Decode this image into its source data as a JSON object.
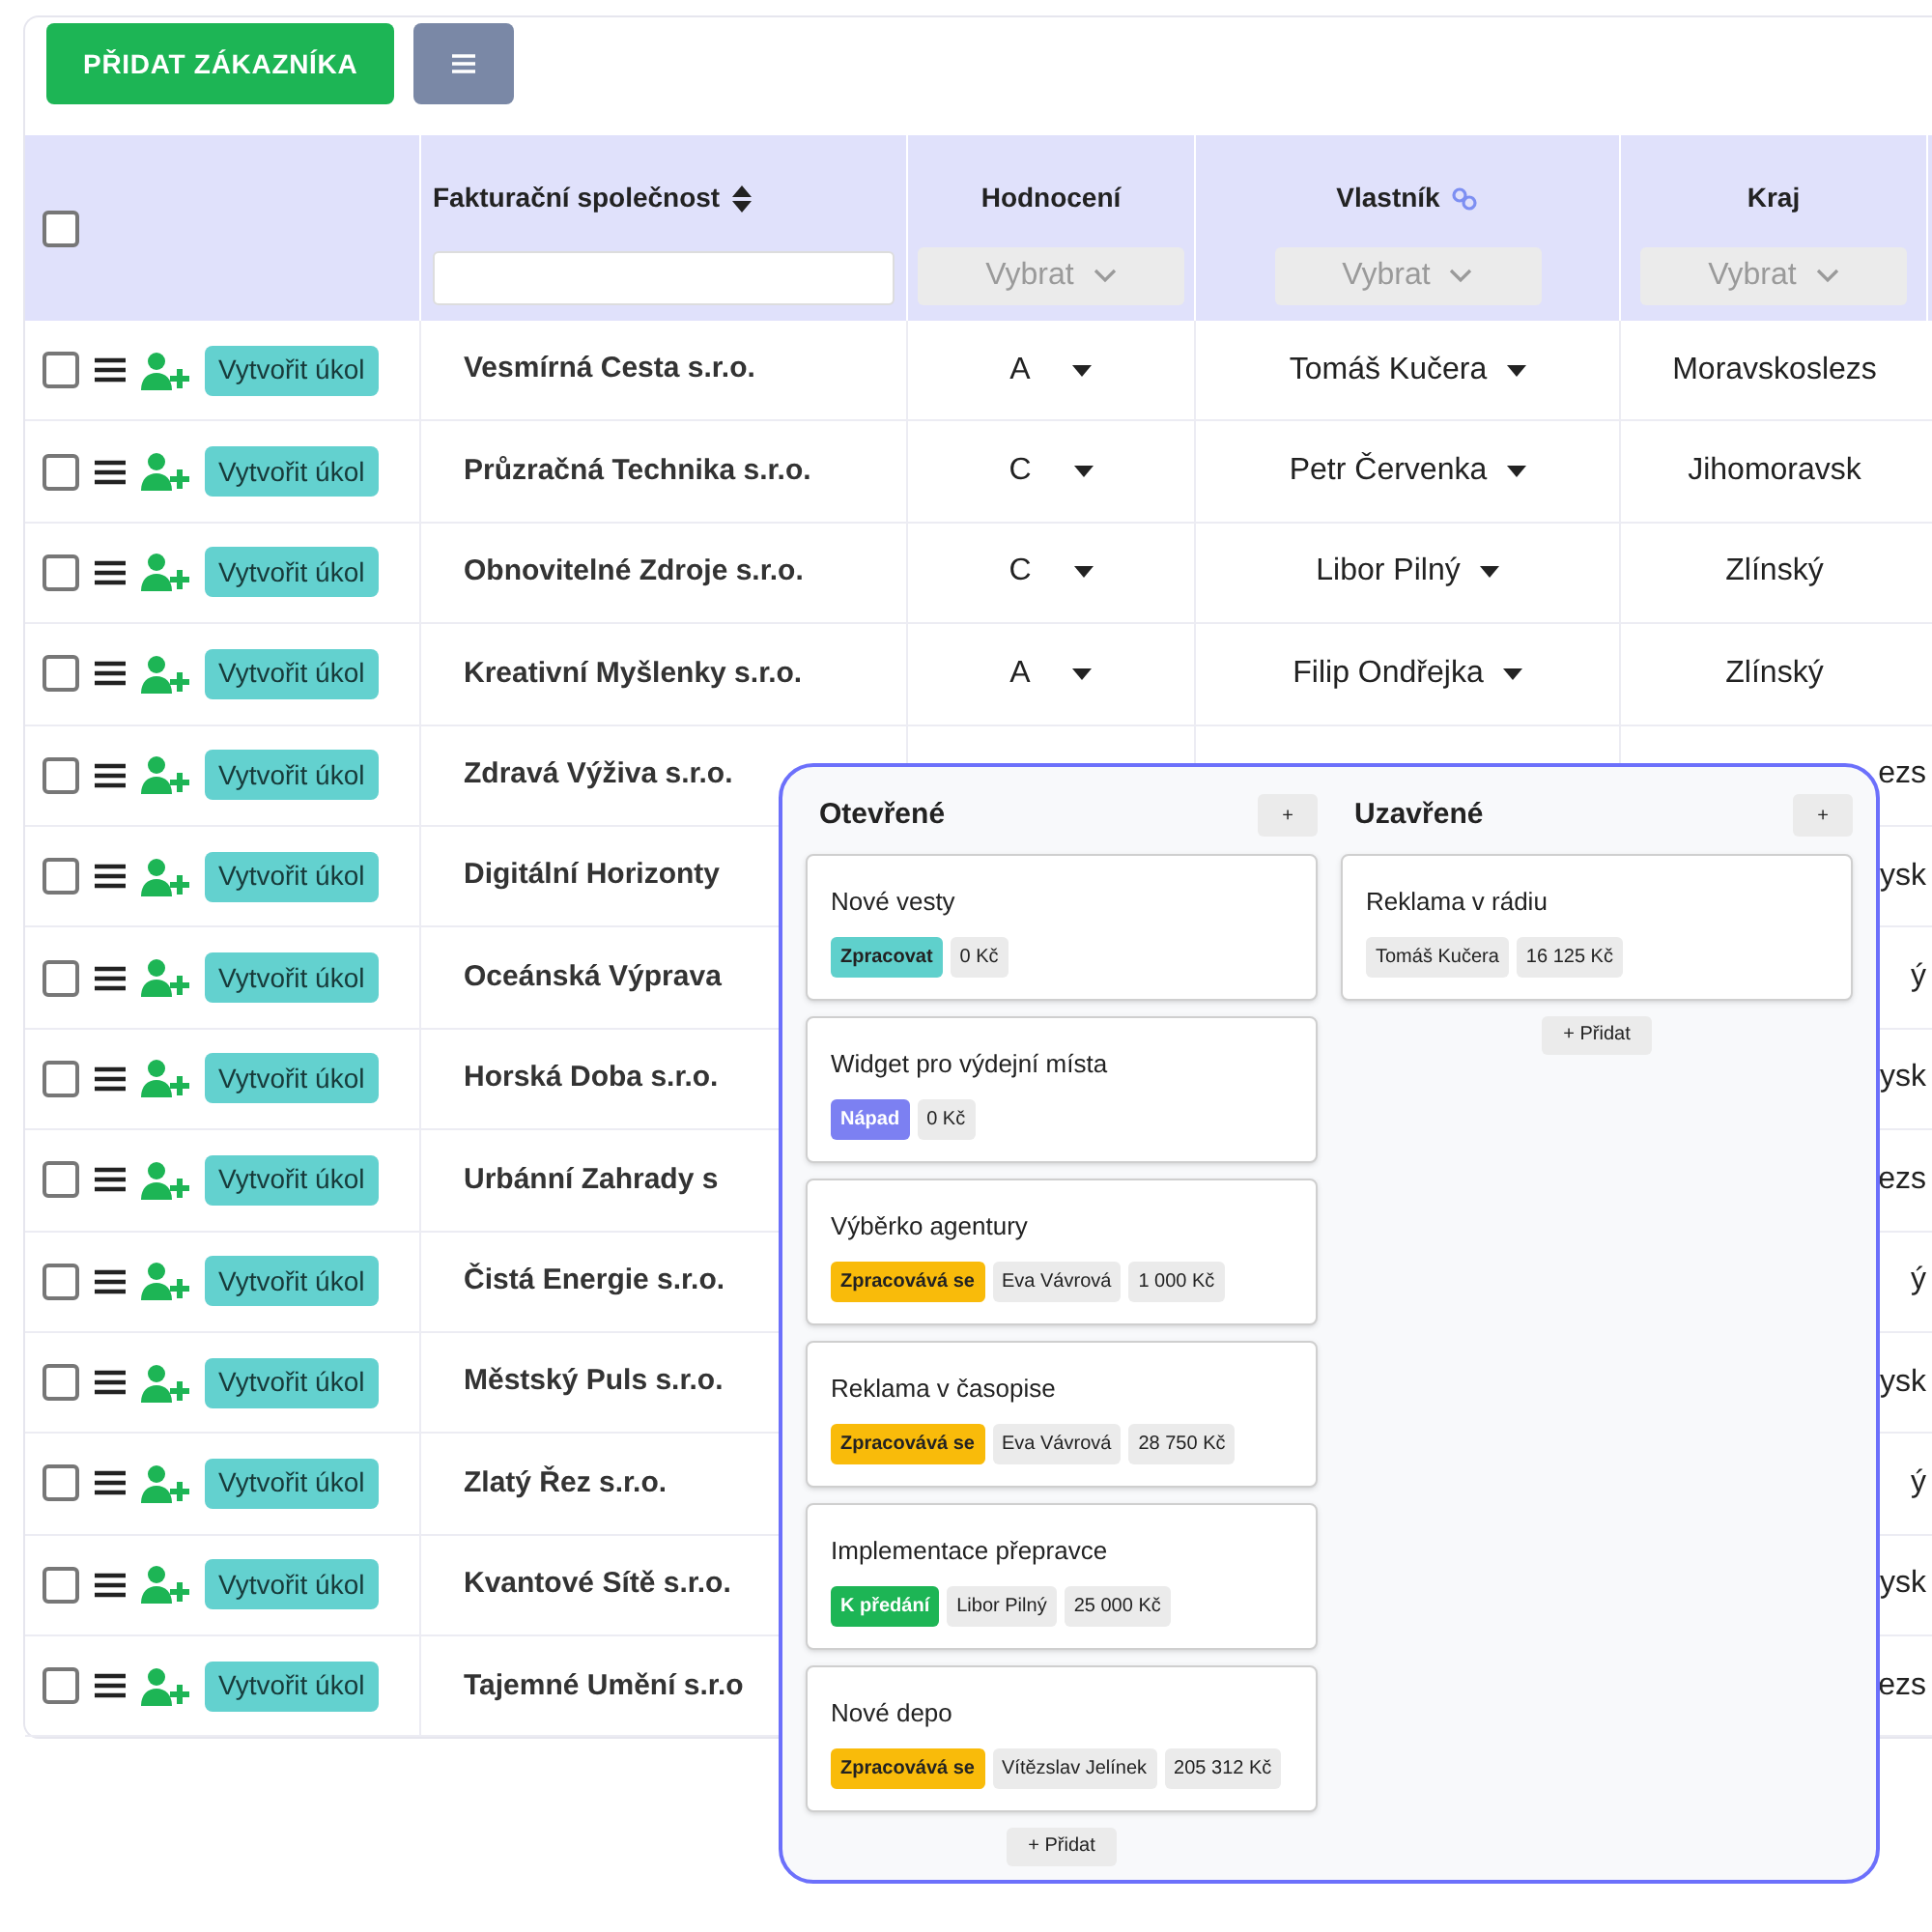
{
  "toolbar": {
    "add_button": "PŘIDAT ZÁKAZNÍKA"
  },
  "table": {
    "select_all_checked": false,
    "columns": [
      {
        "label": "Fakturační společnost"
      },
      {
        "label": "Hodnocení",
        "placeholder": "Vybrat"
      },
      {
        "label": "Vlastník",
        "placeholder": "Vybrat"
      },
      {
        "label": "Kraj",
        "placeholder": "Vybrat"
      }
    ],
    "rows": [
      {
        "checked": false,
        "covered": false,
        "task_button": "Vytvořit úkol",
        "company": "Vesmírná Cesta s.r.o.",
        "rating": "A",
        "owner": "Tomáš Kučera",
        "region": "Moravskoslezs"
      },
      {
        "checked": false,
        "covered": false,
        "task_button": "Vytvořit úkol",
        "company": "Průzračná Technika s.r.o.",
        "rating": "C",
        "owner": "Petr Červenka",
        "region": "Jihomoravsk"
      },
      {
        "checked": false,
        "covered": false,
        "task_button": "Vytvořit úkol",
        "company": "Obnovitelné Zdroje s.r.o.",
        "rating": "C",
        "owner": "Libor Pilný",
        "region": "Zlínský"
      },
      {
        "checked": false,
        "covered": false,
        "task_button": "Vytvořit úkol",
        "company": "Kreativní Myšlenky s.r.o.",
        "rating": "A",
        "owner": "Filip Ondřejka",
        "region": "Zlínský"
      },
      {
        "checked": false,
        "covered": true,
        "task_button": "Vytvořit úkol",
        "company": "Zdravá Výživa s.r.o.",
        "region": "ezs"
      },
      {
        "checked": false,
        "covered": true,
        "task_button": "Vytvořit úkol",
        "company": "Digitální Horizonty",
        "region": "ysk"
      },
      {
        "checked": false,
        "covered": true,
        "task_button": "Vytvořit úkol",
        "company": "Oceánská Výprava",
        "region": "ý"
      },
      {
        "checked": false,
        "covered": true,
        "task_button": "Vytvořit úkol",
        "company": "Horská Doba s.r.o.",
        "region": "ysk"
      },
      {
        "checked": false,
        "covered": true,
        "task_button": "Vytvořit úkol",
        "company": "Urbánní Zahrady s",
        "region": "ezs"
      },
      {
        "checked": false,
        "covered": true,
        "task_button": "Vytvořit úkol",
        "company": "Čistá Energie s.r.o.",
        "region": "ý"
      },
      {
        "checked": false,
        "covered": true,
        "task_button": "Vytvořit úkol",
        "company": "Městský Puls s.r.o.",
        "region": "ysk"
      },
      {
        "checked": false,
        "covered": true,
        "task_button": "Vytvořit úkol",
        "company": "Zlatý Řez s.r.o.",
        "region": "ý"
      },
      {
        "checked": false,
        "covered": true,
        "task_button": "Vytvořit úkol",
        "company": "Kvantové Sítě s.r.o.",
        "region": "ysk"
      },
      {
        "checked": false,
        "covered": true,
        "task_button": "Vytvořit úkol",
        "company": "Tajemné Umění s.r.o",
        "region": "ezs"
      }
    ]
  },
  "board": {
    "columns": [
      {
        "title": "Otevřené",
        "add_icon": "+",
        "add_button": "+ Přidat",
        "cards": [
          {
            "title": "Nové vesty",
            "tags": [
              {
                "kind": "status",
                "text": "Zpracovat",
                "color": "#5fd0cc"
              },
              {
                "kind": "info",
                "text": "0 Kč"
              }
            ]
          },
          {
            "title": "Widget pro výdejní místa",
            "tags": [
              {
                "kind": "status",
                "text": "Nápad",
                "color": "#7c80f2"
              },
              {
                "kind": "info",
                "text": "0 Kč"
              }
            ]
          },
          {
            "title": "Výběrko agentury",
            "tags": [
              {
                "kind": "status",
                "text": "Zpracovává se",
                "color": "#f9bb0a"
              },
              {
                "kind": "info",
                "text": "Eva Vávrová"
              },
              {
                "kind": "info",
                "text": "1 000 Kč"
              }
            ]
          },
          {
            "title": "Reklama v časopise",
            "tags": [
              {
                "kind": "status",
                "text": "Zpracovává se",
                "color": "#f9bb0a"
              },
              {
                "kind": "info",
                "text": "Eva Vávrová"
              },
              {
                "kind": "info",
                "text": "28 750 Kč"
              }
            ]
          },
          {
            "title": "Implementace přepravce",
            "tags": [
              {
                "kind": "status",
                "text": "K předání",
                "color": "#1db555"
              },
              {
                "kind": "info",
                "text": "Libor Pilný"
              },
              {
                "kind": "info",
                "text": "25 000 Kč"
              }
            ]
          },
          {
            "title": "Nové depo",
            "tags": [
              {
                "kind": "status",
                "text": "Zpracovává se",
                "color": "#f9bb0a"
              },
              {
                "kind": "info",
                "text": "Vítězslav Jelínek"
              },
              {
                "kind": "info",
                "text": "205 312 Kč"
              }
            ]
          }
        ]
      },
      {
        "title": "Uzavřené",
        "add_icon": "+",
        "add_button": "+ Přidat",
        "cards": [
          {
            "title": "Reklama v rádiu",
            "tags": [
              {
                "kind": "info",
                "text": "Tomáš Kučera"
              },
              {
                "kind": "info",
                "text": "16 125 Kč"
              }
            ]
          }
        ]
      }
    ]
  }
}
